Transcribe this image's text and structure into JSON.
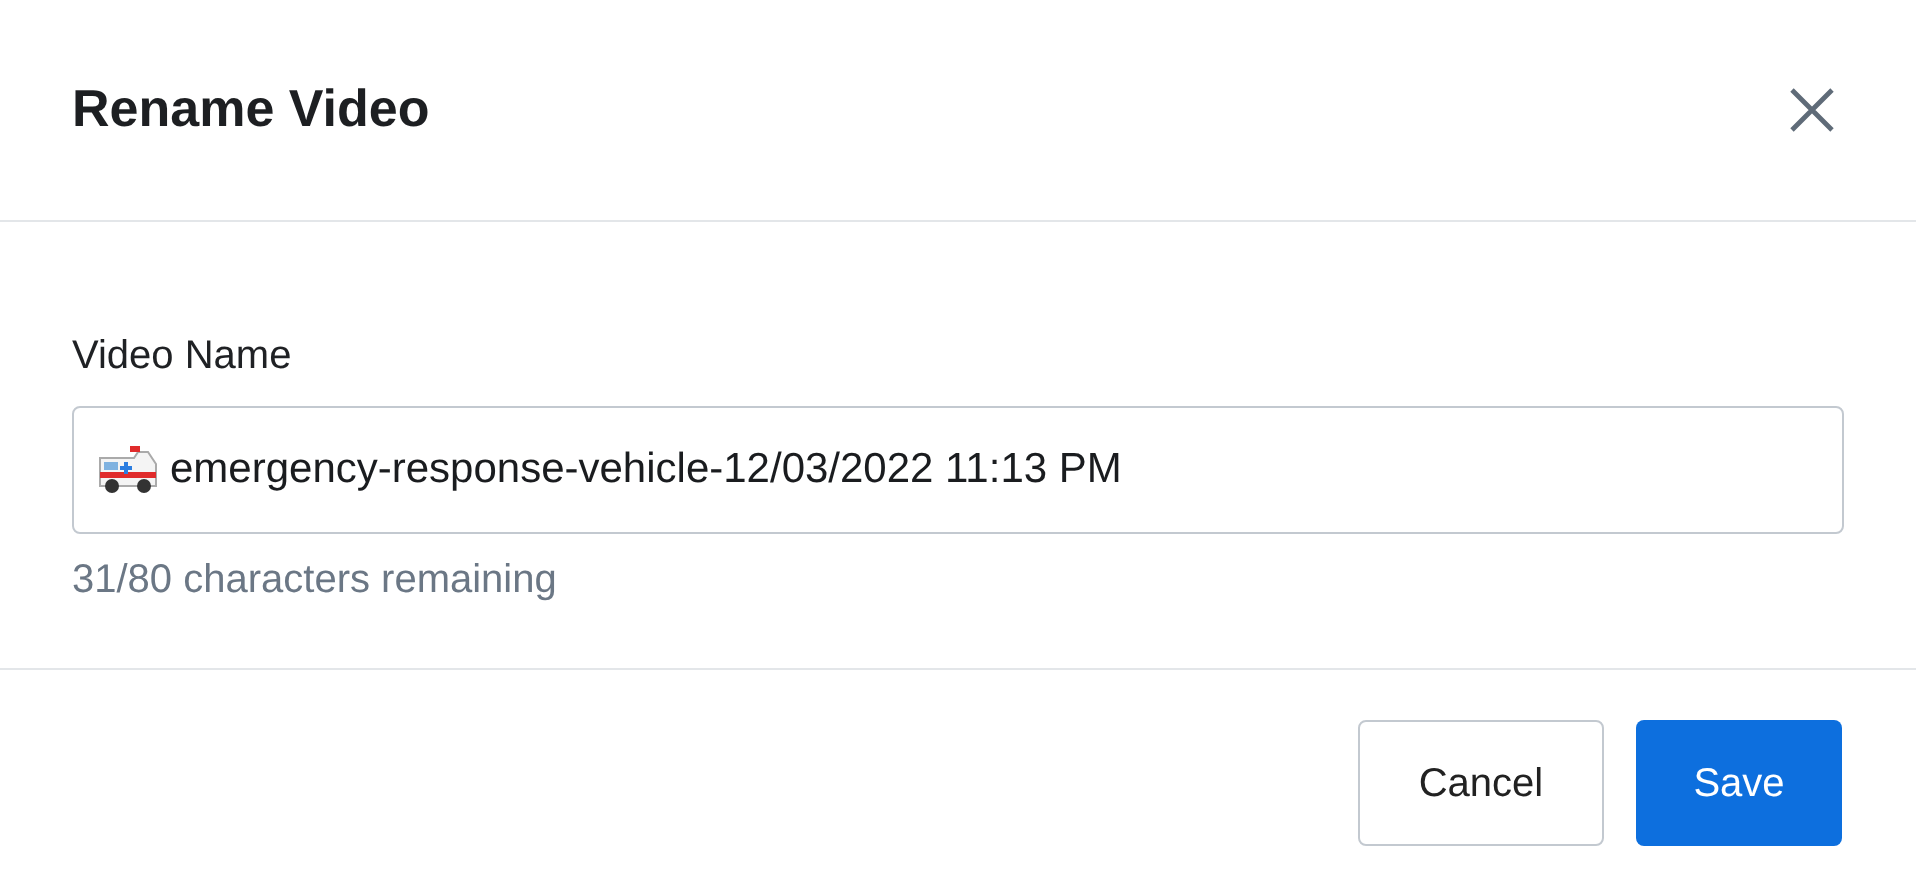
{
  "dialog": {
    "title": "Rename Video",
    "field": {
      "label": "Video Name",
      "value": "emergency-response-vehicle-12/03/2022 11:13 PM",
      "help": "31/80 characters remaining"
    },
    "buttons": [
      {
        "label": "Cancel",
        "kind": "secondary"
      },
      {
        "label": "Save",
        "kind": "primary"
      }
    ]
  }
}
